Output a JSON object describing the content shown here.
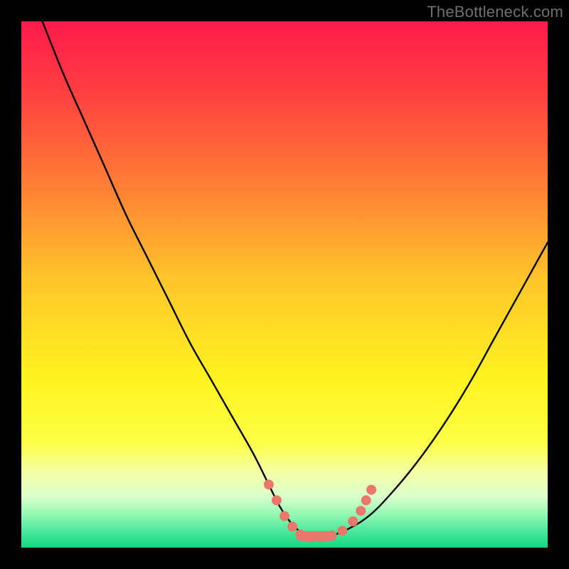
{
  "watermark": {
    "text": "TheBottleneck.com"
  },
  "colors": {
    "black": "#000000",
    "curve": "#000000",
    "marker": "#e9776b",
    "gradient_stops": [
      {
        "offset": 0.0,
        "color": "#ff1a4b"
      },
      {
        "offset": 0.12,
        "color": "#ff3a42"
      },
      {
        "offset": 0.3,
        "color": "#ff7a35"
      },
      {
        "offset": 0.5,
        "color": "#ffc82a"
      },
      {
        "offset": 0.68,
        "color": "#fff31f"
      },
      {
        "offset": 0.8,
        "color": "#fcff45"
      },
      {
        "offset": 0.86,
        "color": "#f3ffaa"
      },
      {
        "offset": 0.905,
        "color": "#d8ffcc"
      },
      {
        "offset": 0.94,
        "color": "#8cf7b0"
      },
      {
        "offset": 0.97,
        "color": "#48e79a"
      },
      {
        "offset": 1.0,
        "color": "#13d67f"
      }
    ]
  },
  "chart_data": {
    "type": "line",
    "title": "",
    "xlabel": "",
    "ylabel": "",
    "xlim": [
      0,
      100
    ],
    "ylim": [
      0,
      100
    ],
    "grid": false,
    "legend": false,
    "series": [
      {
        "name": "bottleneck-curve",
        "x": [
          4,
          8,
          12,
          16,
          20,
          24,
          28,
          32,
          36,
          40,
          44,
          47,
          49,
          51,
          53,
          55,
          57,
          59,
          62,
          66,
          70,
          75,
          80,
          85,
          90,
          95,
          100
        ],
        "y": [
          100,
          90,
          81,
          72,
          63,
          55,
          47,
          39,
          32,
          25,
          18,
          12,
          8,
          5,
          3,
          2.2,
          2,
          2.3,
          3.5,
          6,
          10,
          16,
          23,
          31,
          40,
          49,
          58
        ]
      }
    ],
    "markers": {
      "name": "bottleneck-optimal-range",
      "points": [
        {
          "x": 47.0,
          "y": 12.0
        },
        {
          "x": 48.5,
          "y": 9.0
        },
        {
          "x": 50.0,
          "y": 6.0
        },
        {
          "x": 51.5,
          "y": 4.0
        },
        {
          "x": 53.0,
          "y": 2.5
        },
        {
          "x": 55.0,
          "y": 2.0
        },
        {
          "x": 57.0,
          "y": 2.0
        },
        {
          "x": 59.0,
          "y": 2.3
        },
        {
          "x": 61.0,
          "y": 3.2
        },
        {
          "x": 63.0,
          "y": 5.0
        },
        {
          "x": 64.5,
          "y": 7.0
        },
        {
          "x": 65.5,
          "y": 9.0
        },
        {
          "x": 66.5,
          "y": 11.0
        }
      ]
    }
  }
}
